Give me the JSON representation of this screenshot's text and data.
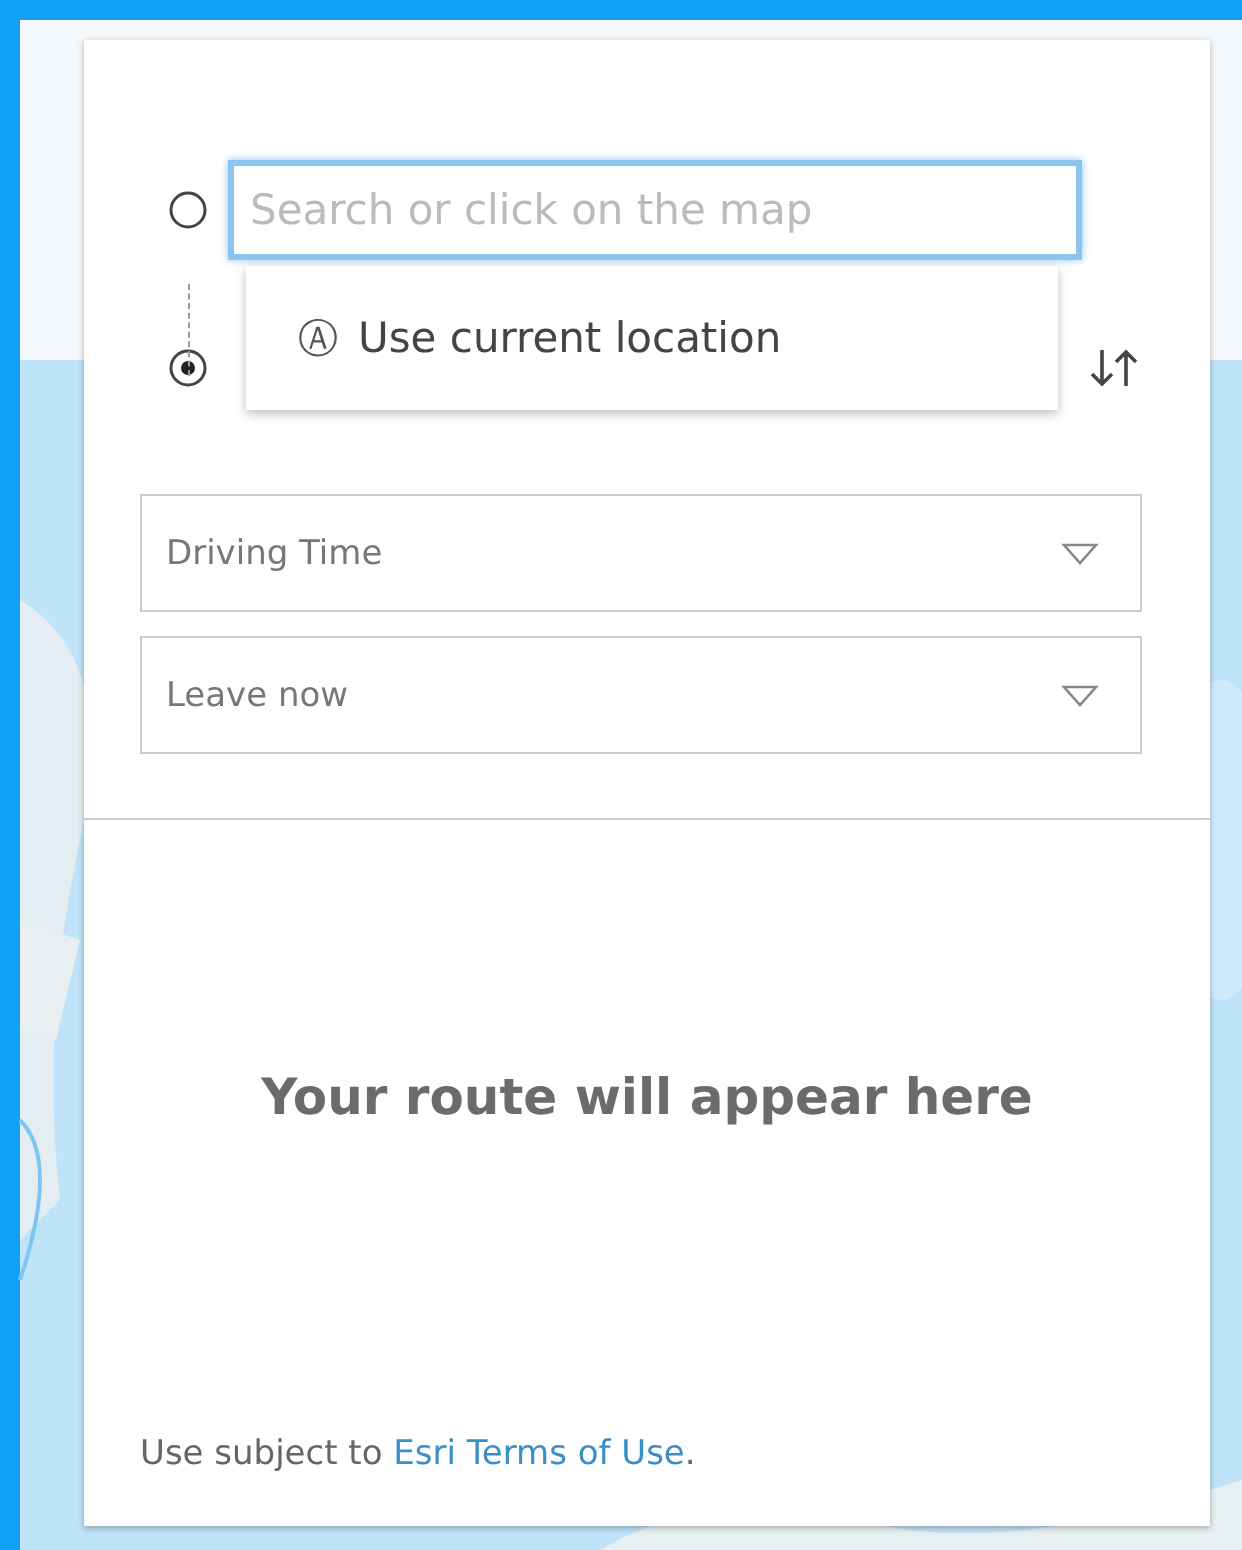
{
  "directions": {
    "stops": [
      {
        "kind": "origin",
        "placeholder": "Search or click on the map",
        "focused": true
      },
      {
        "kind": "destination"
      }
    ],
    "suggestion": {
      "icon": "Ⓐ",
      "text": "Use current location"
    },
    "options": [
      {
        "value": "Driving Time"
      },
      {
        "value": "Leave now"
      }
    ],
    "empty_message": "Your route will appear here",
    "footer": {
      "prefix": "Use subject to",
      "link": "Esri Terms of Use",
      "suffix": "."
    }
  }
}
